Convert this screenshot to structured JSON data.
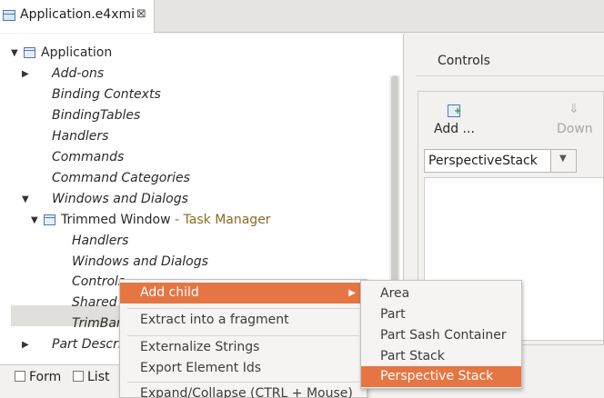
{
  "editor_tab": {
    "title": "Application.e4xmi",
    "close": "⊠"
  },
  "tree": {
    "root": "Application",
    "items": [
      "Add-ons",
      "Binding Contexts",
      "BindingTables",
      "Handlers",
      "Commands",
      "Command Categories",
      "Windows and Dialogs"
    ],
    "trimmed_window": {
      "name": "Trimmed Window",
      "decoration": " - Task Manager"
    },
    "children": [
      "Handlers",
      "Windows and Dialogs",
      "Controls",
      "Shared E",
      "TrimBars"
    ],
    "part_desc": "Part Descri"
  },
  "bottom_tabs": {
    "form": "Form",
    "list": "List"
  },
  "details": {
    "title": "Controls",
    "add_label": "Add ...",
    "down_label": "Down",
    "combo_value": "PerspectiveStack"
  },
  "context_menu": {
    "add_child": "Add child",
    "extract": "Extract into a fragment",
    "externalize": "Externalize Strings",
    "export_ids": "Export Element Ids",
    "expand": "Expand/Collapse (CTRL + Mouse)"
  },
  "submenu": {
    "items": [
      "Area",
      "Part",
      "Part Sash Container",
      "Part Stack",
      "Perspective Stack"
    ],
    "highlighted": "Perspective Stack"
  },
  "colors": {
    "highlight": "#e57643",
    "decoration": "#8d6a23"
  }
}
